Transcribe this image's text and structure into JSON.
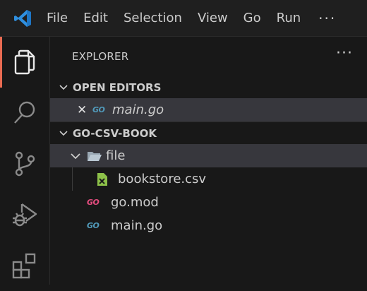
{
  "menu": {
    "items": [
      "File",
      "Edit",
      "Selection",
      "View",
      "Go",
      "Run"
    ],
    "more": "···"
  },
  "activity_bar": {
    "icons": [
      "explorer-icon",
      "search-icon",
      "source-control-icon",
      "run-debug-icon",
      "extensions-icon"
    ],
    "accent": "#ea6b52"
  },
  "explorer": {
    "title": "EXPLORER",
    "more": "···",
    "open_editors": {
      "label": "OPEN EDITORS",
      "items": [
        {
          "icon": "go-file-icon",
          "name": "main.go",
          "close": "✕"
        }
      ]
    },
    "project": {
      "label": "GO-CSV-BOOK",
      "folder": {
        "name": "file",
        "children": [
          {
            "icon": "csv-file-icon",
            "name": "bookstore.csv"
          }
        ]
      },
      "files": [
        {
          "icon": "go-mod-icon",
          "name": "go.mod"
        },
        {
          "icon": "go-file-icon",
          "name": "main.go"
        }
      ]
    }
  },
  "go_icon_text": "GO"
}
